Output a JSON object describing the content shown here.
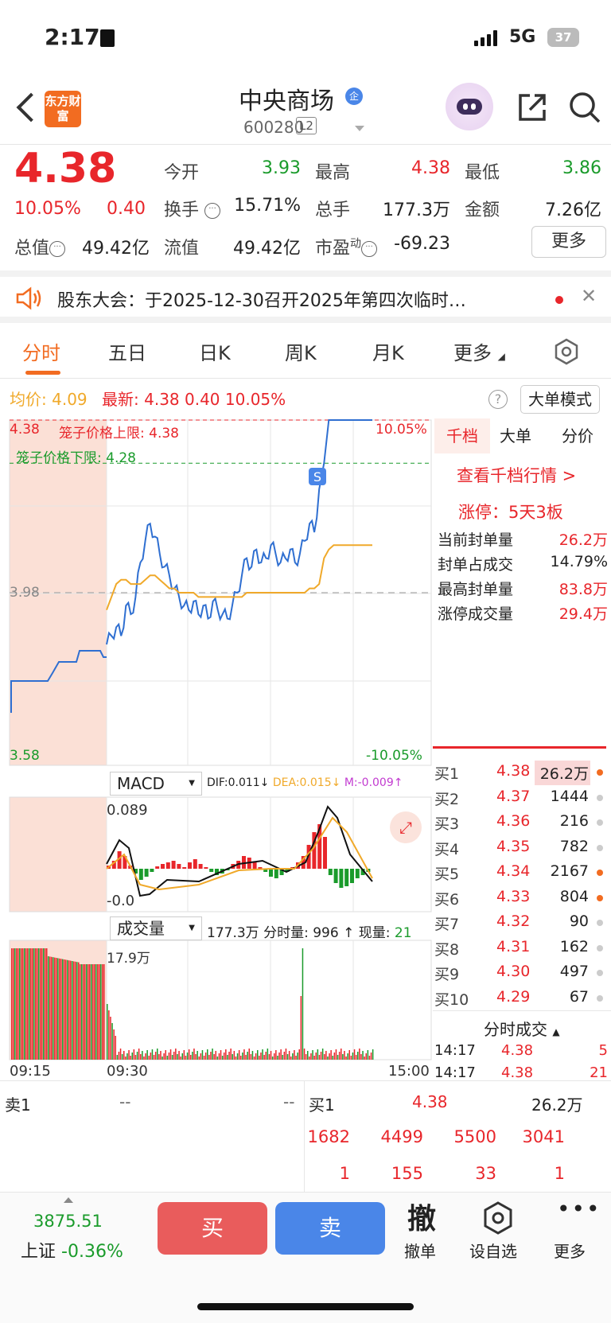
{
  "status_bar": {
    "time": "2:17",
    "network": "5G",
    "battery": "37"
  },
  "header": {
    "logo": "东方财富",
    "name": "中央商场",
    "badge": "企",
    "code": "600280",
    "level": "L2"
  },
  "quote": {
    "price": "4.38",
    "change_pct": "10.05%",
    "change": "0.40",
    "rows": [
      [
        {
          "label": "今开",
          "value": "3.93",
          "color": "green"
        },
        {
          "label": "最高",
          "value": "4.38",
          "color": "red"
        },
        {
          "label": "最低",
          "value": "3.86",
          "color": "green"
        }
      ],
      [
        {
          "label": "换手",
          "value": "15.71%"
        },
        {
          "label": "总手",
          "value": "177.3万"
        },
        {
          "label": "金额",
          "value": "7.26亿"
        }
      ],
      [
        {
          "label": "总值",
          "value": "49.42亿"
        },
        {
          "label": "流值",
          "value": "49.42亿"
        },
        {
          "label": "市盈",
          "sup": "动",
          "value": "-69.23"
        }
      ]
    ],
    "more": "更多"
  },
  "notice": {
    "text": "股东大会：于2025-12-30召开2025年第四次临时…"
  },
  "tabs": [
    "分时",
    "五日",
    "日K",
    "周K",
    "月K",
    "更多"
  ],
  "chart_info": {
    "avg_label": "均价:",
    "avg": "4.09",
    "latest_label": "最新:",
    "latest": "4.38",
    "chg": "0.40",
    "pct": "10.05%",
    "mode": "大单模式"
  },
  "chart_data": {
    "type": "line",
    "title": "",
    "y_max_label": "4.38",
    "y_mid_label": "3.98",
    "y_min_label": "3.58",
    "pct_max_label": "10.05%",
    "pct_min_label": "-10.05%",
    "upper_limit_label": "笼子价格上限:",
    "upper_limit": "4.38",
    "lower_limit_label": "笼子价格下限:",
    "lower_limit": "4.28",
    "ylim": [
      3.58,
      4.38
    ],
    "series": [
      {
        "name": "最新",
        "color": "#2f6fd1",
        "values": [
          3.86,
          3.88,
          3.9,
          3.88,
          3.95,
          3.93,
          3.97,
          4.05,
          4.1,
          4.14,
          4.11,
          4.07,
          4.04,
          4.02,
          3.99,
          3.97,
          3.95,
          3.94,
          3.96,
          3.93,
          3.95,
          3.92,
          3.96,
          3.94,
          3.93,
          3.92,
          3.95,
          3.98,
          4.02,
          4.06,
          4.04,
          4.08,
          4.05,
          4.06,
          4.09,
          4.07,
          4.05,
          4.06,
          4.08,
          4.05,
          4.07,
          4.1,
          4.14,
          4.12,
          4.22,
          4.28,
          4.38,
          4.38,
          4.38,
          4.38,
          4.38,
          4.38,
          4.38,
          4.38,
          4.38,
          4.38
        ]
      },
      {
        "name": "均价",
        "color": "#f0a92a",
        "values": [
          3.94,
          3.97,
          4.0,
          4.01,
          4.01,
          4.0,
          4.0,
          4.0,
          4.01,
          4.02,
          4.02,
          4.01,
          4.0,
          3.99,
          3.99,
          3.98,
          3.98,
          3.98,
          3.98,
          3.97,
          3.97,
          3.97,
          3.97,
          3.97,
          3.97,
          3.97,
          3.97,
          3.97,
          3.97,
          3.98,
          3.98,
          3.98,
          3.98,
          3.98,
          3.98,
          3.98,
          3.98,
          3.98,
          3.98,
          3.98,
          3.98,
          3.98,
          3.99,
          3.99,
          4.0,
          4.06,
          4.08,
          4.09,
          4.09,
          4.09,
          4.09,
          4.09,
          4.09,
          4.09,
          4.09,
          4.09
        ]
      }
    ],
    "x_labels": [
      "09:15",
      "09:30",
      "15:00"
    ],
    "macd": {
      "label": "MACD",
      "dif": "DIF:0.011",
      "dea": "DEA:0.015",
      "m": "M:-0.009",
      "top": "0.089",
      "bottom": "-0.0"
    },
    "volume": {
      "label": "成交量",
      "total": "177.3万",
      "split_label": "分时量:",
      "split": "996",
      "now_label": "现量:",
      "now": "21",
      "max_label": "17.9万"
    }
  },
  "right_panel": {
    "tabs": [
      "千档",
      "大单",
      "分价"
    ],
    "link": "查看千档行情 >",
    "limit_up": "涨停：5天3板",
    "stats": [
      {
        "label": "当前封单量",
        "value": "26.2万"
      },
      {
        "label": "封单占成交",
        "value": "14.79%"
      },
      {
        "label": "最高封单量",
        "value": "83.8万"
      },
      {
        "label": "涨停成交量",
        "value": "29.4万"
      }
    ],
    "bids": [
      {
        "label": "买1",
        "price": "4.38",
        "vol": "26.2万",
        "dot": "orange"
      },
      {
        "label": "买2",
        "price": "4.37",
        "vol": "1444",
        "dot": "gray"
      },
      {
        "label": "买3",
        "price": "4.36",
        "vol": "216",
        "dot": "gray"
      },
      {
        "label": "买4",
        "price": "4.35",
        "vol": "782",
        "dot": "gray"
      },
      {
        "label": "买5",
        "price": "4.34",
        "vol": "2167",
        "dot": "orange"
      },
      {
        "label": "买6",
        "price": "4.33",
        "vol": "804",
        "dot": "orange"
      },
      {
        "label": "买7",
        "price": "4.32",
        "vol": "90",
        "dot": "gray"
      },
      {
        "label": "买8",
        "price": "4.31",
        "vol": "162",
        "dot": "gray"
      },
      {
        "label": "买9",
        "price": "4.30",
        "vol": "497",
        "dot": "gray"
      },
      {
        "label": "买10",
        "price": "4.29",
        "vol": "67",
        "dot": "gray"
      }
    ],
    "trades_title": "分时成交",
    "trades": [
      {
        "time": "14:17",
        "price": "4.38",
        "vol": "5"
      },
      {
        "time": "14:17",
        "price": "4.38",
        "vol": "21"
      }
    ]
  },
  "orderbook": {
    "sell_label": "卖1",
    "sell_price": "--",
    "sell_vol": "--",
    "buy_label": "买1",
    "buy_price": "4.38",
    "buy_vol": "26.2万",
    "row1": [
      "1682",
      "4499",
      "5500",
      "3041"
    ],
    "row2": [
      "1",
      "155",
      "33",
      "1"
    ]
  },
  "bottom": {
    "index_value": "3875.51",
    "index_name": "上证",
    "index_pct": "-0.36%",
    "buy": "买",
    "sell": "卖",
    "cancel_icon": "撤",
    "cancel": "撤单",
    "watch": "设自选",
    "more": "更多"
  }
}
